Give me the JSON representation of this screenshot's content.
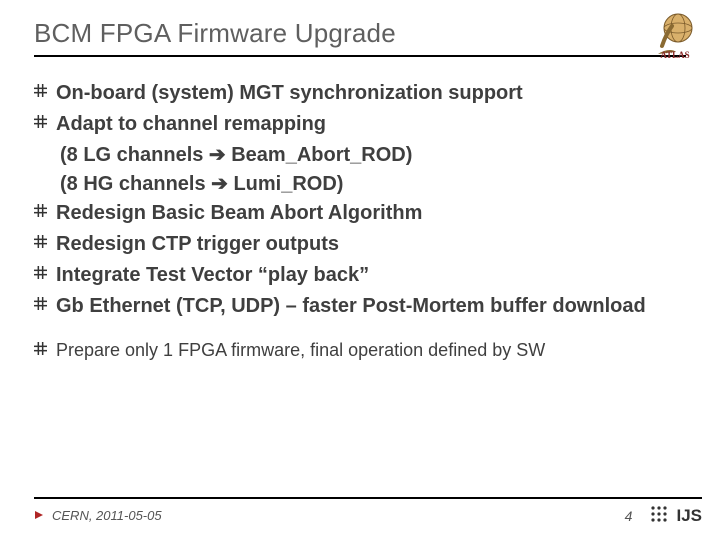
{
  "header": {
    "title": "BCM FPGA Firmware Upgrade"
  },
  "bullets": {
    "b1": "On-board (system) MGT synchronization support",
    "b2": "Adapt to channel remapping",
    "b2_sub1": "(8 LG channels ➔ Beam_Abort_ROD)",
    "b2_sub2": "(8 HG channels ➔ Lumi_ROD)",
    "b3": "Redesign Basic Beam Abort Algorithm",
    "b4": "Redesign CTP trigger outputs",
    "b5": "Integrate Test Vector “play back”",
    "b6": "Gb Ethernet (TCP, UDP) – faster Post-Mortem buffer download",
    "s1": "Prepare only 1 FPGA firmware, final operation defined by SW"
  },
  "footer": {
    "location_date": "CERN, 2011-05-05",
    "page": "4",
    "ijs": "IJS"
  }
}
